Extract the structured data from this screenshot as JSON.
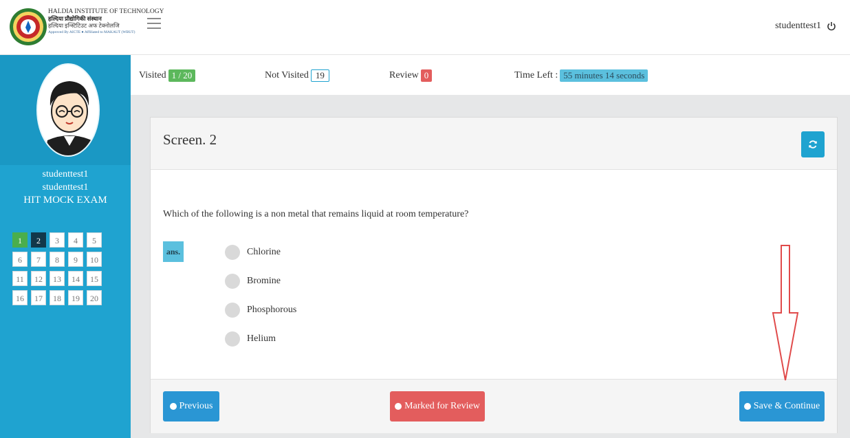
{
  "header": {
    "logo_line1": "HALDIA INSTITUTE OF TECHNOLOGY",
    "logo_line2": "हल्दिया प्रौद्योगिकी संस्थान",
    "logo_line3": "हल्दिया इन्स्टिटिउट अफ टेक्नोलजि",
    "logo_line4": "Approved By AICTE ● Affiliated to MAKAUT (WBUT)",
    "username": "studenttest1"
  },
  "sidebar": {
    "name_line1": "studenttest1",
    "name_line2": "studenttest1",
    "exam_name": "HIT MOCK EXAM",
    "questions": [
      {
        "n": "1",
        "state": "visited"
      },
      {
        "n": "2",
        "state": "current"
      },
      {
        "n": "3",
        "state": "new"
      },
      {
        "n": "4",
        "state": "new"
      },
      {
        "n": "5",
        "state": "new"
      },
      {
        "n": "6",
        "state": "new"
      },
      {
        "n": "7",
        "state": "new"
      },
      {
        "n": "8",
        "state": "new"
      },
      {
        "n": "9",
        "state": "new"
      },
      {
        "n": "10",
        "state": "new"
      },
      {
        "n": "11",
        "state": "new"
      },
      {
        "n": "12",
        "state": "new"
      },
      {
        "n": "13",
        "state": "new"
      },
      {
        "n": "14",
        "state": "new"
      },
      {
        "n": "15",
        "state": "new"
      },
      {
        "n": "16",
        "state": "new"
      },
      {
        "n": "17",
        "state": "new"
      },
      {
        "n": "18",
        "state": "new"
      },
      {
        "n": "19",
        "state": "new"
      },
      {
        "n": "20",
        "state": "new"
      }
    ]
  },
  "status": {
    "visited_label": "Visited",
    "visited_value": "1 / 20",
    "not_visited_label": "Not Visited",
    "not_visited_value": "19",
    "review_label": "Review",
    "review_value": "0",
    "time_label": "Time Left :",
    "time_value": "55 minutes 14 seconds"
  },
  "card": {
    "title": "Screen. 2",
    "question": "Which of the following is a non metal that remains liquid at room temperature?",
    "ans_tag": "ans.",
    "options": [
      "Chlorine",
      "Bromine",
      "Phosphorous",
      "Helium"
    ]
  },
  "footer": {
    "previous_label": "Previous",
    "review_label": "Marked for Review",
    "save_label": "Save & Continue"
  },
  "colors": {
    "sidebar": "#1fa3d0",
    "primary_button": "#2a96d4",
    "review_button": "#e35d5d",
    "visited_green": "#5cb85c",
    "annotation_arrow": "#e04a4a"
  },
  "icons": {
    "hamburger": "menu-icon",
    "power": "power-icon",
    "refresh": "refresh-icon",
    "previous": "chevron-left-circle-icon",
    "review": "eye-icon",
    "save": "chevron-right-circle-icon"
  }
}
